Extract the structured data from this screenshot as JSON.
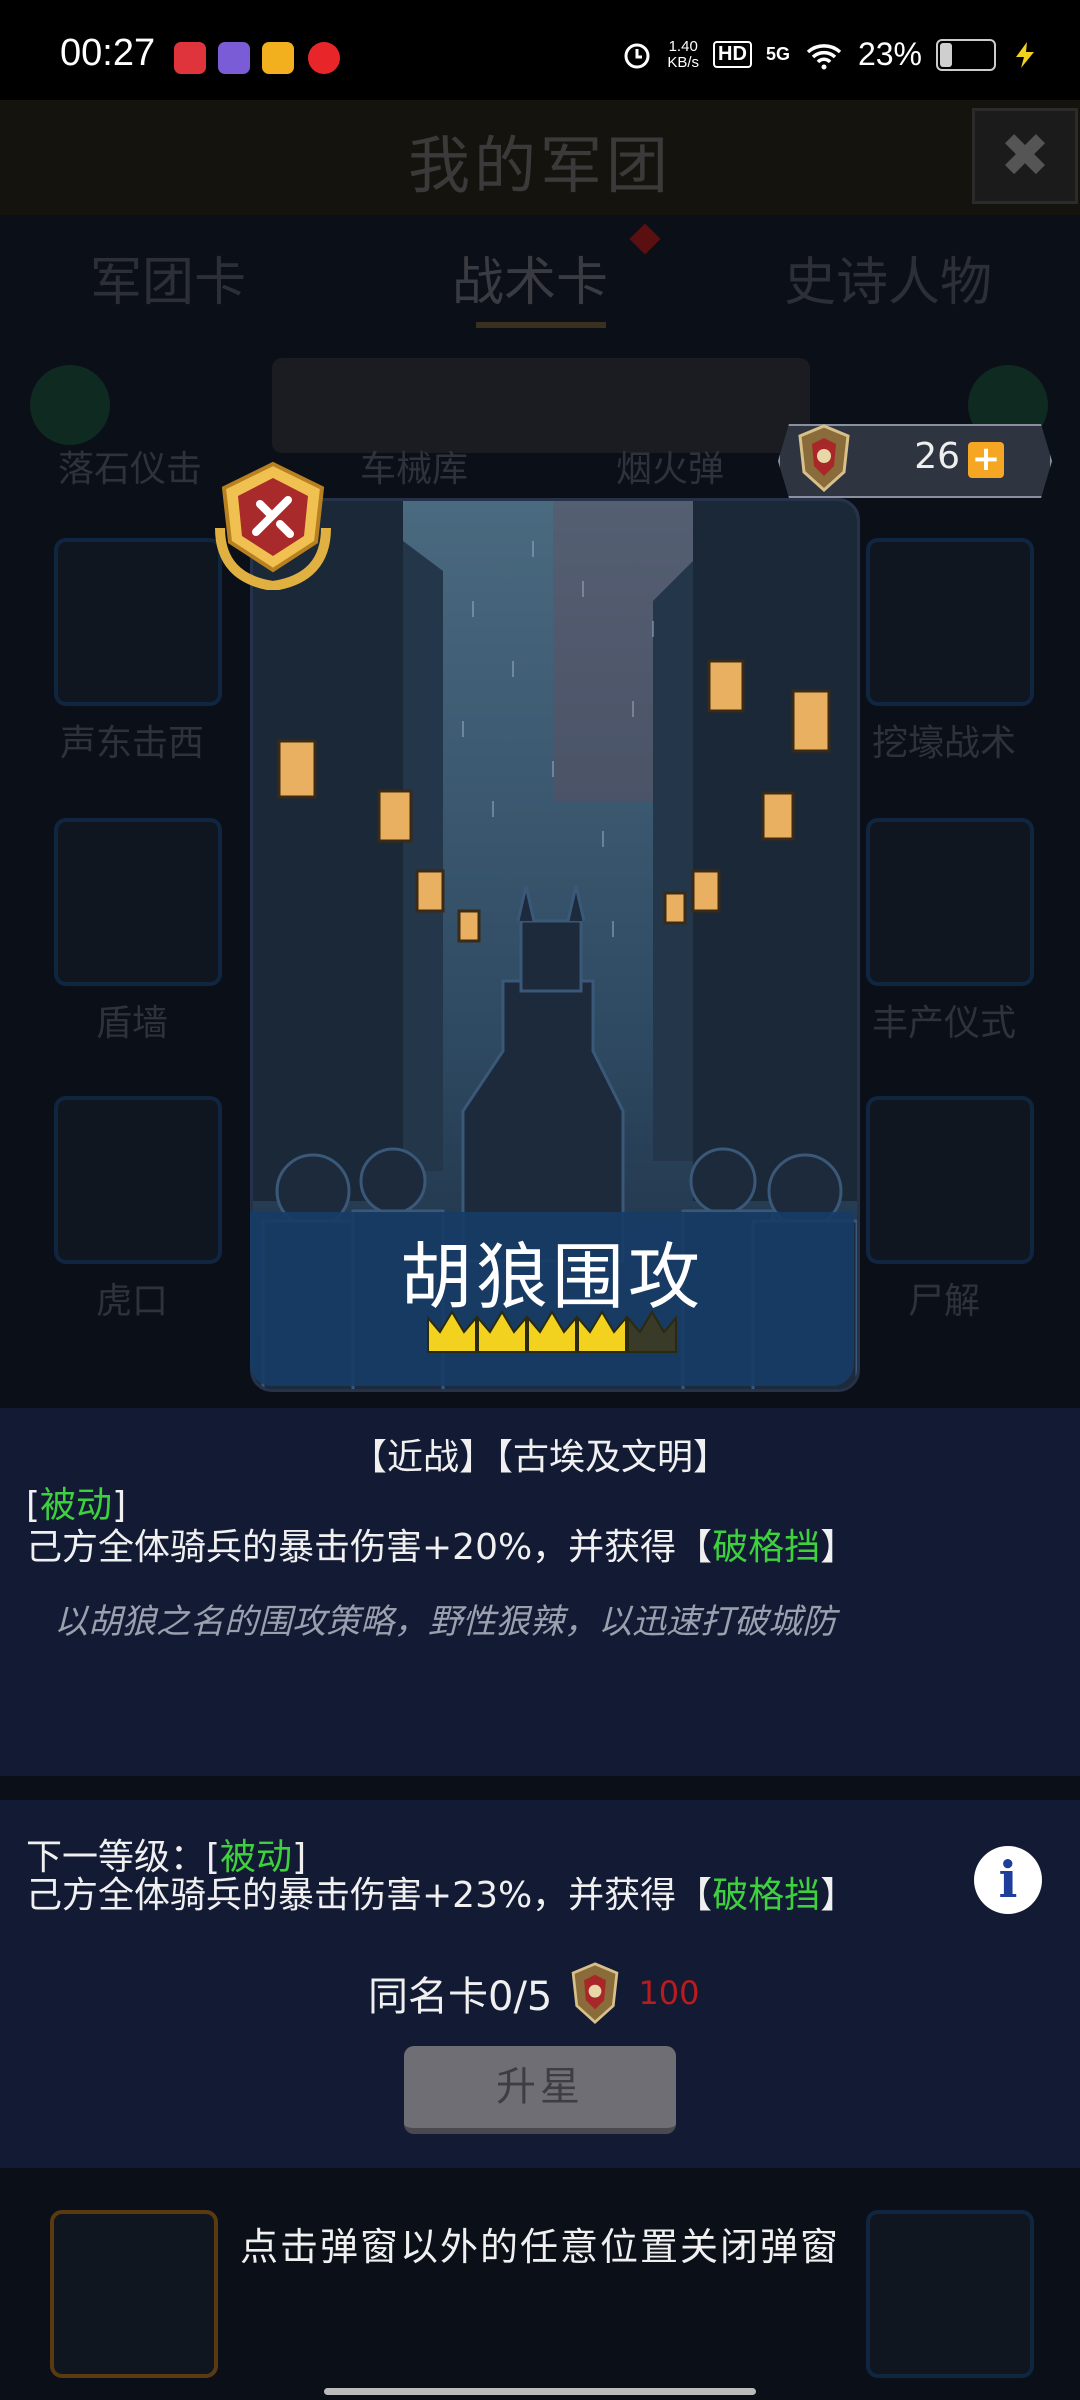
{
  "status_bar": {
    "time": "00:27",
    "net_speed_value": "1.40",
    "net_speed_unit": "KB/s",
    "hd_label": "HD",
    "signal_label": "5G",
    "battery_percent": "23%",
    "battery_level": 0.23
  },
  "header": {
    "title": "我的军团",
    "close_label": "✖"
  },
  "tabs": [
    {
      "label": "军团卡"
    },
    {
      "label": "战术卡"
    },
    {
      "label": "史诗人物"
    }
  ],
  "background_cards": {
    "row0_partial": [
      "落石仪击",
      "车械库",
      "烟火弹"
    ],
    "left_column": [
      "声东击西",
      "盾墙",
      "虎口"
    ],
    "right_column": [
      "挖壕战术",
      "丰产仪式",
      "尸解"
    ]
  },
  "currency": {
    "value": "26",
    "plus_label": "+"
  },
  "card": {
    "title": "胡狼围攻",
    "stars_filled": 4,
    "stars_total": 5
  },
  "panel": {
    "tags": "【近战】【古埃及文明】",
    "current_open": "[",
    "current_type": "被动",
    "current_close": "]",
    "current_desc": "己方全体骑兵的暴击伤害+20%，并获得【",
    "current_buff": "破格挡",
    "current_desc_end": "】",
    "flavor": "以胡狼之名的围攻策略，野性狠辣，以迅速打破城防",
    "next_prefix": "下一等级：[",
    "next_type": "被动",
    "next_close": "]",
    "next_desc": "己方全体骑兵的暴击伤害+23%，并获得【",
    "next_buff": "破格挡",
    "next_desc_end": "】",
    "info_label": "i",
    "duplicate_label": "同名卡0/5",
    "duplicate_cost": "100",
    "upgrade_label": "升星",
    "close_hint": "点击弹窗以外的任意位置关闭弹窗"
  },
  "colors": {
    "highlight_green": "#3ed13e",
    "cost_red": "#b81c1c",
    "currency_plus": "#f5a623"
  }
}
